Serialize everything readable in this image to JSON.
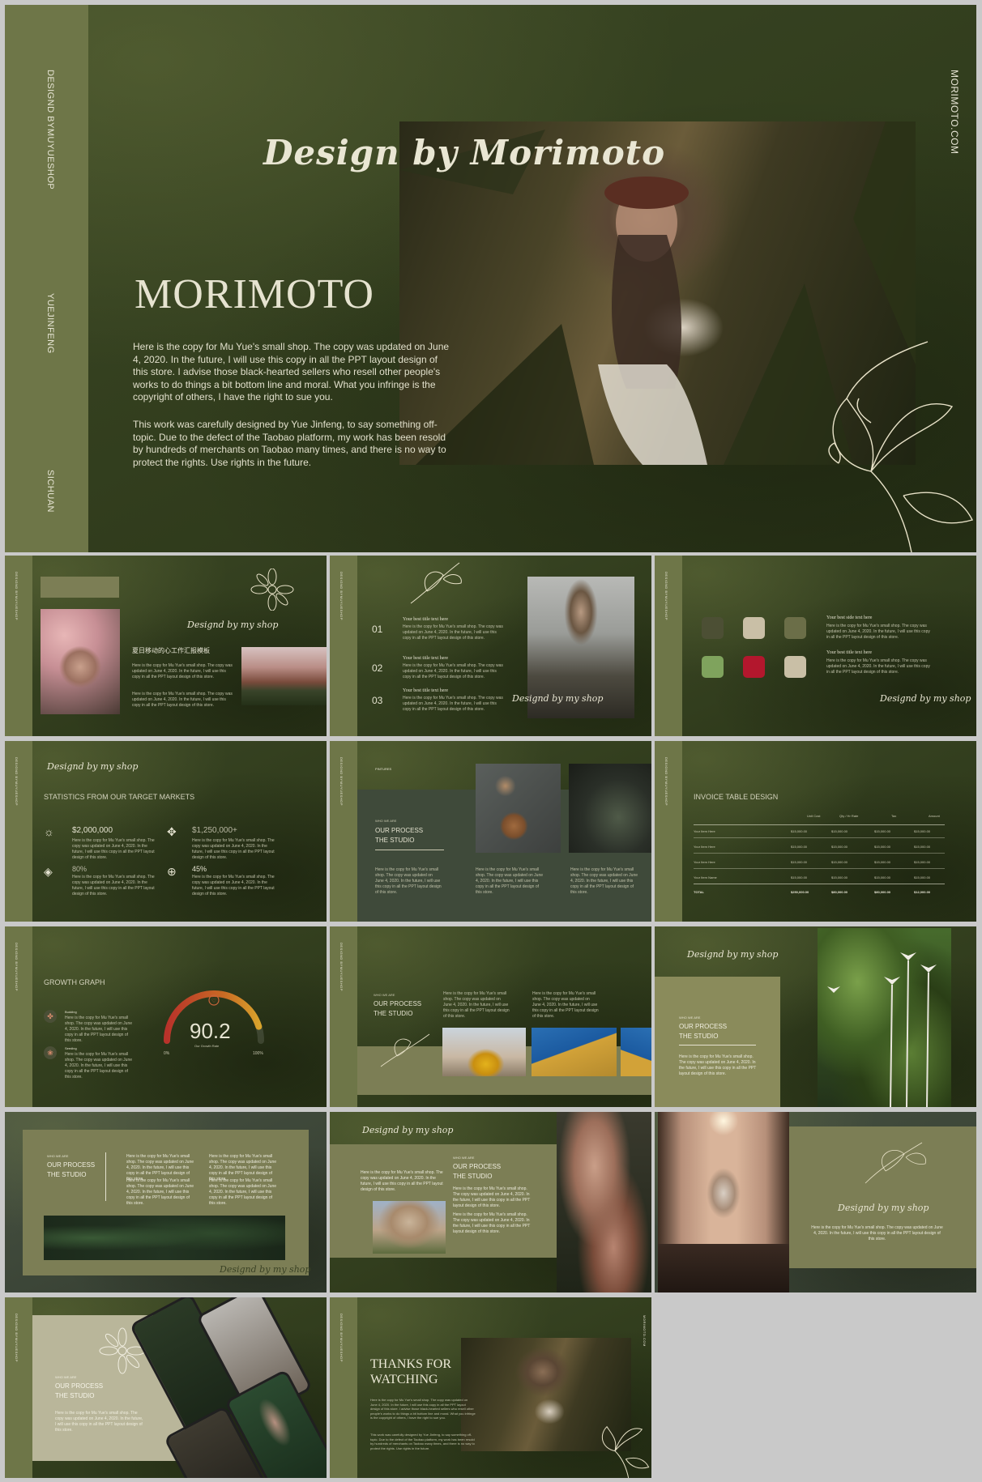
{
  "main": {
    "side_top": "DESIGND BYMUYUESHOP",
    "side_mid": "YUEJINFENG",
    "side_bot": "SICHUAN",
    "right_vertical": "MORIMOTO.COM",
    "script_title": "Design by Morimoto",
    "title": "MORIMOTO",
    "para1": "Here is the copy for Mu Yue's small shop. The copy was updated on June 4, 2020. In the future, I will use this copy in all the PPT layout design of this store. I advise those black-hearted sellers who resell other people's works to do things a bit bottom line and moral. What you infringe is the copyright of others, I have the right to sue you.",
    "para2": "This work was carefully designed by Yue Jinfeng, to say something off-topic. Due to the defect of the Taobao platform, my work has been resold by hundreds of merchants on Taobao many times, and there is no way to protect the rights. Use rights in the future."
  },
  "common": {
    "designed_by": "Designd by my shop",
    "side_label": "DESIGND BYMUYUESHOP",
    "who_we_are": "WHO WE ARE",
    "our_process": "OUR PROCESS",
    "the_studio": "THE STUDIO",
    "filler": "Here is the copy for Mu Yue's small shop. The copy was updated on June 4, 2020. In the future, I will use this copy in all the PPT layout design of this store."
  },
  "s1": {
    "cn_title": "夏日移动的心工作汇报模板"
  },
  "s2": {
    "items": [
      {
        "num": "01",
        "title": "Your best title text here"
      },
      {
        "num": "02",
        "title": "Your best title text here"
      },
      {
        "num": "03",
        "title": "Your best title text here"
      }
    ]
  },
  "s3": {
    "title1": "Your best side text here",
    "title2": "Your best title text here"
  },
  "s4": {
    "heading": "STATISTICS FROM OUR TARGET MARKETS",
    "stats": [
      {
        "value": "$2,000,000",
        "icon": "sun-icon"
      },
      {
        "value": "$1,250,000+",
        "icon": "move-icon"
      },
      {
        "value": "80%",
        "icon": "layers-icon"
      },
      {
        "value": "45%",
        "icon": "globe-icon"
      }
    ]
  },
  "s5": {
    "tag": "PINTURES"
  },
  "s6": {
    "heading": "INVOICE TABLE DESIGN",
    "columns": [
      "Unit Cost",
      "Qty / Hr Rate",
      "Tax",
      "Amount"
    ],
    "rows": [
      [
        "Your Item Here",
        "$15,000.00",
        "$15,000.00",
        "$15,000.00",
        "$15,000.00"
      ],
      [
        "Your Item Here",
        "$15,000.00",
        "$15,000.00",
        "$15,000.00",
        "$15,000.00"
      ],
      [
        "Your Item Here",
        "$15,000.00",
        "$15,000.00",
        "$15,000.00",
        "$15,000.00"
      ],
      [
        "Your Item Name",
        "$15,000.00",
        "$15,000.00",
        "$15,000.00",
        "$15,000.00"
      ]
    ],
    "total": [
      "TOTAL",
      "$250,000.00",
      "$80,000.00",
      "$80,000.00",
      "$12,000.00"
    ]
  },
  "s7": {
    "heading": "GROWTH GRAPH",
    "value": "90.2",
    "value_label": "Our Growth Rate",
    "min": "0%",
    "max": "100%",
    "item1": "Budding",
    "item2": "Seeding",
    "level": 0.902
  },
  "thanks": {
    "line1": "THANKS FOR",
    "line2": "WATCHING"
  },
  "colors": {
    "bg": "#33401c",
    "sage": "#7c7e55",
    "strip": "#6e7648",
    "text": "#e8e6d6"
  }
}
